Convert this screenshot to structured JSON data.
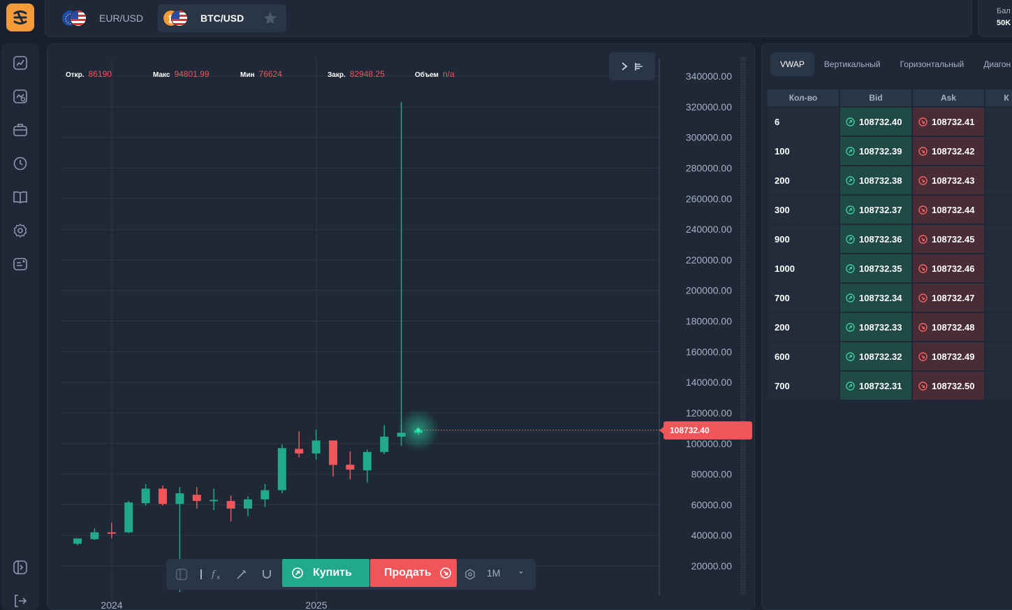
{
  "topbar": {
    "tabs": [
      {
        "label": "EUR/USD",
        "active": false
      },
      {
        "label": "BTC/USD",
        "active": true
      }
    ],
    "balance_label": "Бал",
    "balance_value": "50K"
  },
  "sidebar": {
    "icons": [
      "chart-icon",
      "analytics-icon",
      "briefcase-icon",
      "clock-icon",
      "book-icon",
      "settings-icon",
      "news-icon",
      "play-icon",
      "logout-icon"
    ]
  },
  "ohlc": {
    "open_label": "Откр.",
    "open_value": "86190",
    "high_label": "Макс",
    "high_value": "94801.99",
    "low_label": "Мин",
    "low_value": "76624",
    "close_label": "Закр.",
    "close_value": "82948.25",
    "volume_label": "Объем",
    "volume_value": "n/a"
  },
  "current_price": "108732.40",
  "colors": {
    "up": "#22a88a",
    "down": "#f0555a",
    "bg": "#1e2836",
    "accent": "#f39a3b"
  },
  "chart_data": {
    "type": "candlestick",
    "ylim": [
      0,
      350000
    ],
    "y_ticks": [
      "340000.00",
      "320000.00",
      "300000.00",
      "280000.00",
      "260000.00",
      "240000.00",
      "220000.00",
      "200000.00",
      "180000.00",
      "160000.00",
      "140000.00",
      "120000.00",
      "100000.00",
      "80000.00",
      "60000.00",
      "40000.00",
      "20000.00"
    ],
    "x_ticks": [
      "2024",
      "2025"
    ],
    "candles": [
      {
        "o": 34500,
        "h": 37000,
        "l": 33500,
        "c": 38000
      },
      {
        "o": 37500,
        "h": 44500,
        "l": 37000,
        "c": 42000
      },
      {
        "o": 42000,
        "h": 48500,
        "l": 38000,
        "c": 41500
      },
      {
        "o": 42000,
        "h": 62500,
        "l": 41500,
        "c": 61500
      },
      {
        "o": 61000,
        "h": 73500,
        "l": 59500,
        "c": 70500
      },
      {
        "o": 70500,
        "h": 72500,
        "l": 59500,
        "c": 60500
      },
      {
        "o": 60500,
        "h": 71500,
        "l": 3000,
        "c": 67500
      },
      {
        "o": 66500,
        "h": 71500,
        "l": 57500,
        "c": 62500
      },
      {
        "o": 63000,
        "h": 70500,
        "l": 56500,
        "c": 63200
      },
      {
        "o": 62500,
        "h": 66000,
        "l": 49000,
        "c": 57500
      },
      {
        "o": 57500,
        "h": 65500,
        "l": 52500,
        "c": 63500
      },
      {
        "o": 63500,
        "h": 73500,
        "l": 58500,
        "c": 69500
      },
      {
        "o": 69500,
        "h": 99500,
        "l": 67500,
        "c": 97000
      },
      {
        "o": 96500,
        "h": 108000,
        "l": 91000,
        "c": 93500
      },
      {
        "o": 93500,
        "h": 109000,
        "l": 89500,
        "c": 102000
      },
      {
        "o": 102000,
        "h": 102000,
        "l": 78500,
        "c": 86000
      },
      {
        "o": 86190,
        "h": 94801.99,
        "l": 76624,
        "c": 82948.25
      },
      {
        "o": 82500,
        "h": 96000,
        "l": 74500,
        "c": 94500
      },
      {
        "o": 94500,
        "h": 112000,
        "l": 93000,
        "c": 104500
      },
      {
        "o": 104500,
        "h": 323000,
        "l": 98500,
        "c": 107000
      },
      {
        "o": 107000,
        "h": 110000,
        "l": 105500,
        "c": 108732.4
      }
    ]
  },
  "toolbar": {
    "buy_label": "Купить",
    "sell_label": "Продать",
    "timeframe": "1M"
  },
  "orderbook": {
    "tabs": [
      "VWAP",
      "Вертикальный",
      "Горизонтальный",
      "Диагон"
    ],
    "headers": [
      "Кол-во",
      "Bid",
      "Ask",
      "К"
    ],
    "rows": [
      {
        "qty": "6",
        "bid": "108732.40",
        "ask": "108732.41"
      },
      {
        "qty": "100",
        "bid": "108732.39",
        "ask": "108732.42"
      },
      {
        "qty": "200",
        "bid": "108732.38",
        "ask": "108732.43"
      },
      {
        "qty": "300",
        "bid": "108732.37",
        "ask": "108732.44"
      },
      {
        "qty": "900",
        "bid": "108732.36",
        "ask": "108732.45"
      },
      {
        "qty": "1000",
        "bid": "108732.35",
        "ask": "108732.46"
      },
      {
        "qty": "700",
        "bid": "108732.34",
        "ask": "108732.47"
      },
      {
        "qty": "200",
        "bid": "108732.33",
        "ask": "108732.48"
      },
      {
        "qty": "600",
        "bid": "108732.32",
        "ask": "108732.49"
      },
      {
        "qty": "700",
        "bid": "108732.31",
        "ask": "108732.50"
      }
    ]
  }
}
